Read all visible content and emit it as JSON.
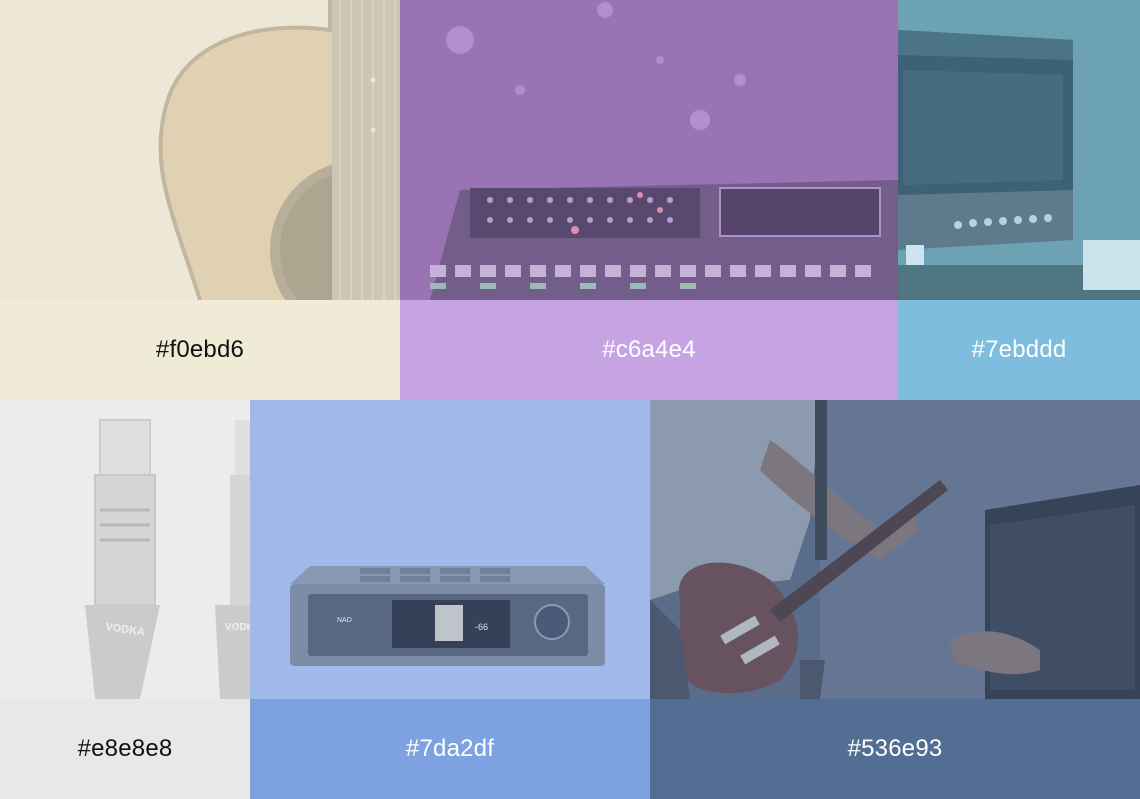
{
  "swatches": [
    {
      "hex_label": "#f0ebd6",
      "color": "#f0ebd6",
      "photo": "acoustic-guitar"
    },
    {
      "hex_label": "#c6a4e4",
      "color": "#c6a4e4",
      "photo": "mixing-console"
    },
    {
      "hex_label": "#7ebddd",
      "color": "#7ebddd",
      "photo": "guitar-amplifier"
    },
    {
      "hex_label": "#e8e8e8",
      "color": "#e8e8e8",
      "photo": "ethernet-connectors"
    },
    {
      "hex_label": "#7da2df",
      "color": "#7da2df",
      "photo": "audio-amplifier"
    },
    {
      "hex_label": "#536e93",
      "color": "#536e93",
      "photo": "guitarist-with-amp"
    }
  ],
  "product_text": {
    "connector_brand": "VODKA",
    "amp_brand": "NAD",
    "amp_volume": "-66"
  }
}
